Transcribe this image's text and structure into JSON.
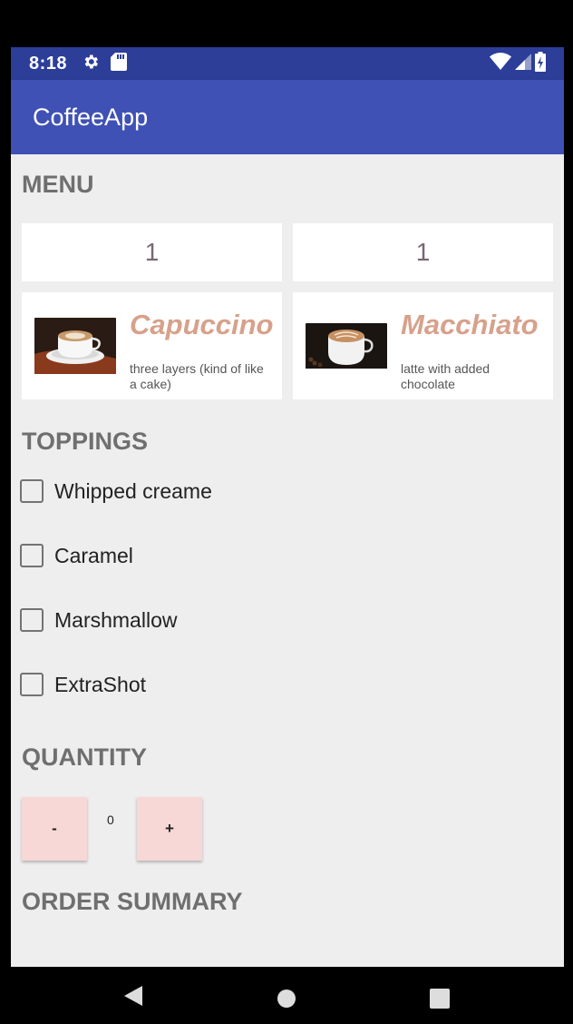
{
  "status_bar": {
    "time": "8:18",
    "icons": [
      "settings-icon",
      "sd-card-icon",
      "wifi-icon",
      "signal-icon",
      "battery-charging-icon"
    ]
  },
  "app_bar": {
    "title": "CoffeeApp",
    "color": "#3f51b5"
  },
  "menu": {
    "title": "MENU",
    "items": [
      {
        "quantity": "1",
        "name": "Capuccino",
        "description": " three layers (kind of like a cake)"
      },
      {
        "quantity": "1",
        "name": "Macchiato",
        "description": "latte with added chocolate"
      }
    ]
  },
  "toppings": {
    "title": "TOPPINGS",
    "items": [
      {
        "label": "Whipped creame",
        "checked": false
      },
      {
        "label": "Caramel",
        "checked": false
      },
      {
        "label": "Marshmallow",
        "checked": false
      },
      {
        "label": "ExtraShot",
        "checked": false
      }
    ]
  },
  "quantity": {
    "title": "QUANTITY",
    "decrement_label": "-",
    "value": "0",
    "increment_label": "+"
  },
  "order_summary": {
    "title": "ORDER SUMMARY"
  },
  "nav_bar": {
    "icons": [
      "back-icon",
      "home-icon",
      "recents-icon"
    ]
  },
  "colors": {
    "accent": "#d7a18b",
    "button": "#f8d7d7",
    "background": "#eeeeee",
    "status_bar": "#2c3e98"
  }
}
